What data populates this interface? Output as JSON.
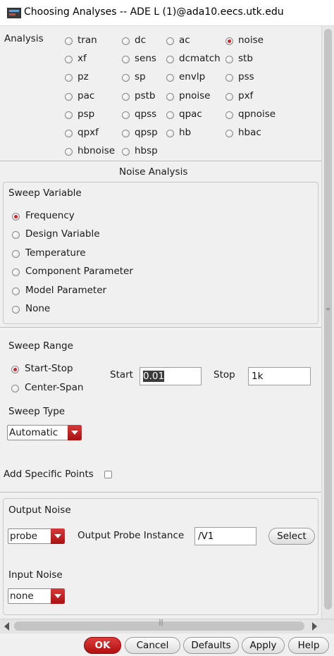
{
  "window": {
    "title": "Choosing Analyses -- ADE L (1)@ada10.eecs.utk.edu"
  },
  "analysis": {
    "label": "Analysis",
    "selected": "noise",
    "options": [
      "tran",
      "dc",
      "ac",
      "noise",
      "xf",
      "sens",
      "dcmatch",
      "stb",
      "pz",
      "sp",
      "envlp",
      "pss",
      "pac",
      "pstb",
      "pnoise",
      "pxf",
      "psp",
      "qpss",
      "qpac",
      "qpnoise",
      "qpxf",
      "qpsp",
      "hb",
      "hbac",
      "hbnoise",
      "hbsp"
    ]
  },
  "section_title": "Noise Analysis",
  "sweep_variable": {
    "label": "Sweep Variable",
    "selected": "Frequency",
    "options": [
      "Frequency",
      "Design Variable",
      "Temperature",
      "Component Parameter",
      "Model Parameter",
      "None"
    ]
  },
  "sweep_range": {
    "label": "Sweep Range",
    "selected": "Start-Stop",
    "options": [
      "Start-Stop",
      "Center-Span"
    ],
    "start_label": "Start",
    "start_value": "0.01",
    "stop_label": "Stop",
    "stop_value": "1k"
  },
  "sweep_type": {
    "label": "Sweep Type",
    "value": "Automatic"
  },
  "add_specific_points": {
    "label": "Add Specific Points",
    "checked": false
  },
  "output_noise": {
    "label": "Output Noise",
    "value": "probe",
    "instance_label": "Output Probe Instance",
    "instance_value": "/V1",
    "select_label": "Select"
  },
  "input_noise": {
    "label": "Input Noise",
    "value": "none"
  },
  "buttons": {
    "ok": "OK",
    "cancel": "Cancel",
    "defaults": "Defaults",
    "apply": "Apply",
    "help": "Help"
  },
  "colors": {
    "accent": "#d0222a",
    "button_ok": "#c0181a"
  }
}
